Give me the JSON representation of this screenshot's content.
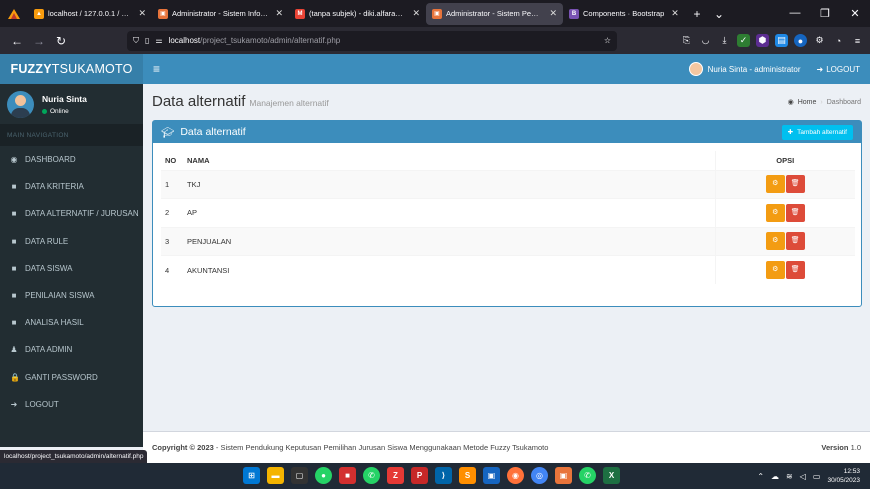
{
  "browser": {
    "tabs": [
      {
        "title": "localhost / 127.0.0.1 / project_ts",
        "fav_color": "#f89c0e",
        "fav_glyph": "▲",
        "active": false
      },
      {
        "title": "Administrator - Sistem Informa",
        "fav_color": "#e8743b",
        "fav_glyph": "▣",
        "active": false
      },
      {
        "title": "(tanpa subjek) - diki.alfarabi.ha",
        "fav_color": "#ea4335",
        "fav_glyph": "M",
        "active": false
      },
      {
        "title": "Administrator - Sistem Penduk",
        "fav_color": "#e8743b",
        "fav_glyph": "▣",
        "active": true
      },
      {
        "title": "Components · Bootstrap",
        "fav_color": "#7952b3",
        "fav_glyph": "B",
        "active": false
      }
    ],
    "url_host": "localhost",
    "url_path": "/project_tsukamoto/admin/alternatif.php",
    "status_url": "localhost/project_tsukamoto/admin/alternatif.php"
  },
  "header": {
    "logo_bold": "FUZZY",
    "logo_rest": "TSUKAMOTO",
    "user_label": "Nuria Sinta - administrator",
    "logout_label": "LOGOUT"
  },
  "sidebar": {
    "user_name": "Nuria Sinta",
    "user_status": "Online",
    "section_header": "MAIN NAVIGATION",
    "items": [
      {
        "label": "DASHBOARD",
        "icon": "dashboard-icon",
        "glyph": "◉"
      },
      {
        "label": "DATA KRITERIA",
        "icon": "folder-icon",
        "glyph": "■"
      },
      {
        "label": "DATA ALTERNATIF / JURUSAN",
        "icon": "folder-icon",
        "glyph": "■"
      },
      {
        "label": "DATA RULE",
        "icon": "folder-icon",
        "glyph": "■"
      },
      {
        "label": "DATA SISWA",
        "icon": "folder-icon",
        "glyph": "■"
      },
      {
        "label": "PENILAIAN SISWA",
        "icon": "folder-icon",
        "glyph": "■"
      },
      {
        "label": "ANALISA HASIL",
        "icon": "folder-icon",
        "glyph": "■"
      },
      {
        "label": "DATA ADMIN",
        "icon": "users-icon",
        "glyph": "♟"
      },
      {
        "label": "GANTI PASSWORD",
        "icon": "lock-icon",
        "glyph": "🔒"
      },
      {
        "label": "LOGOUT",
        "icon": "sign-out-icon",
        "glyph": "➜"
      }
    ]
  },
  "page": {
    "title": "Data alternatif",
    "subtitle": "Manajemen alternatif",
    "breadcrumb_home": "Home",
    "breadcrumb_current": "Dashboard"
  },
  "box": {
    "title": "Data alternatif",
    "add_button": "Tambah alternatif",
    "columns": [
      "NO",
      "NAMA",
      "OPSI"
    ],
    "rows": [
      {
        "no": "1",
        "nama": "TKJ"
      },
      {
        "no": "2",
        "nama": "AP"
      },
      {
        "no": "3",
        "nama": "PENJUALAN"
      },
      {
        "no": "4",
        "nama": "AKUNTANSI"
      }
    ]
  },
  "footer": {
    "copyright_bold": "Copyright © 2023",
    "copyright_rest": " - Sistem Pendukung Keputusan Pemilihan Jurusan Siswa Menggunakaan Metode Fuzzy Tsukamoto",
    "version_label": "Version",
    "version_value": "1.0"
  },
  "taskbar": {
    "time": "12:53",
    "date": "30/05/2023"
  },
  "colors": {
    "primary": "#3c8dbc",
    "logo_bg": "#367fa9",
    "sidebar_bg": "#222d32",
    "edit": "#f39c12",
    "delete": "#dd4b39",
    "add": "#00c0ef"
  }
}
